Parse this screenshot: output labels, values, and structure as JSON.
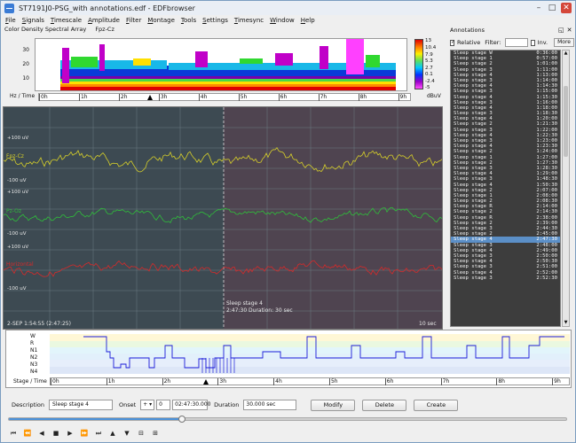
{
  "window": {
    "title": "ST7191J0-PSG_with annotations.edf - EDFbrowser",
    "controls": {
      "minimize": "–",
      "maximize": "□",
      "close": "✕"
    }
  },
  "menu": [
    "File",
    "Signals",
    "Timescale",
    "Amplitude",
    "Filter",
    "Montage",
    "Tools",
    "Settings",
    "Timesync",
    "Window",
    "Help"
  ],
  "csa": {
    "title": "Color Density Spectral Array",
    "channel": "Fpz-Cz",
    "y_ticks": [
      "30",
      "20",
      "10"
    ],
    "scale_labels": [
      "13",
      "10.4",
      "7.9",
      "5.3",
      "2.7",
      "0.1",
      "-2.4",
      "-5"
    ],
    "time_label": "Hz / Time",
    "unit": "dBuV",
    "time_ticks": [
      "0h",
      "1h",
      "2h",
      "3h",
      "4h",
      "5h",
      "6h",
      "7h",
      "8h",
      "9h"
    ],
    "cursor_hours": 2.79
  },
  "signals": {
    "amplitude_labels": [
      "+100 uV",
      "-100 uV",
      "+100 uV",
      "-100 uV",
      "+100 uV",
      "-100 uV"
    ],
    "channels": [
      {
        "name": "Fpz-Cz",
        "color": "#d6cf2a"
      },
      {
        "name": "Pz-Oz",
        "color": "#2fbf3a"
      },
      {
        "name": "Horizontal",
        "color": "#d62a2a"
      }
    ],
    "annotation_label": "Sleep stage 4",
    "annotation_detail": "2:47:30 Duration: 30 sec",
    "start_time": "2-SEP  1:54:55 (2:47:25)",
    "page_duration": "10 sec"
  },
  "annotations": {
    "title": "Annotations",
    "relative_label": "Relative",
    "relative_checked": true,
    "filter_label": "Filter:",
    "filter_value": "",
    "inv_label": "Inv.",
    "inv_checked": false,
    "more_label": "More",
    "rows": [
      [
        "Sleep stage W",
        "0:36:00"
      ],
      [
        "Sleep stage 1",
        "0:57:00"
      ],
      [
        "Sleep stage 2",
        "1:01:00"
      ],
      [
        "Sleep stage 3",
        "1:11:00"
      ],
      [
        "Sleep stage 4",
        "1:13:00"
      ],
      [
        "Sleep stage 3",
        "1:14:00"
      ],
      [
        "Sleep stage 4",
        "1:14:30"
      ],
      [
        "Sleep stage 3",
        "1:15:00"
      ],
      [
        "Sleep stage 4",
        "1:15:30"
      ],
      [
        "Sleep stage 3",
        "1:16:00"
      ],
      [
        "Sleep stage 4",
        "1:18:00"
      ],
      [
        "Sleep stage 3",
        "1:18:30"
      ],
      [
        "Sleep stage 4",
        "1:20:00"
      ],
      [
        "Sleep stage 2",
        "1:21:30"
      ],
      [
        "Sleep stage 3",
        "1:22:00"
      ],
      [
        "Sleep stage 4",
        "1:22:30"
      ],
      [
        "Sleep stage 3",
        "1:23:00"
      ],
      [
        "Sleep stage 4",
        "1:23:30"
      ],
      [
        "Sleep stage 2",
        "1:24:00"
      ],
      [
        "Sleep stage 1",
        "1:27:00"
      ],
      [
        "Sleep stage 2",
        "1:27:30"
      ],
      [
        "Sleep stage 3",
        "1:28:30"
      ],
      [
        "Sleep stage 4",
        "1:29:00"
      ],
      [
        "Sleep stage 3",
        "1:48:30"
      ],
      [
        "Sleep stage 4",
        "1:50:30"
      ],
      [
        "Sleep stage 2",
        "2:07:00"
      ],
      [
        "Sleep stage 1",
        "2:08:00"
      ],
      [
        "Sleep stage 2",
        "2:08:30"
      ],
      [
        "Sleep stage R",
        "2:14:00"
      ],
      [
        "Sleep stage 2",
        "2:14:30"
      ],
      [
        "Sleep stage R",
        "2:38:00"
      ],
      [
        "Sleep stage 2",
        "2:39:00"
      ],
      [
        "Sleep stage 3",
        "2:44:30"
      ],
      [
        "Sleep stage 2",
        "2:45:00"
      ],
      [
        "Sleep stage 4",
        "2:47:30"
      ],
      [
        "Sleep stage 3",
        "2:48:00"
      ],
      [
        "Sleep stage 4",
        "2:49:00"
      ],
      [
        "Sleep stage 3",
        "2:50:00"
      ],
      [
        "Sleep stage 4",
        "2:50:30"
      ],
      [
        "Sleep stage 3",
        "2:51:00"
      ],
      [
        "Sleep stage 4",
        "2:52:00"
      ],
      [
        "Sleep stage 3",
        "2:52:30"
      ]
    ],
    "selected_index": 34
  },
  "hypnogram": {
    "levels": [
      "W",
      "R",
      "N1",
      "N2",
      "N3",
      "N4"
    ],
    "time_label": "Stage / Time",
    "time_ticks": [
      "0h",
      "1h",
      "2h",
      "3h",
      "4h",
      "5h",
      "6h",
      "7h",
      "8h",
      "9h"
    ],
    "cursor_hours": 2.79
  },
  "editor": {
    "description_label": "Description",
    "description_value": "Sleep stage 4",
    "onset_label": "Onset",
    "onset_sign": "+",
    "onset_days": "0",
    "onset_time": "02:47:30.000",
    "duration_label": "Duration",
    "duration_value": "30.000 sec",
    "modify_label": "Modify",
    "delete_label": "Delete",
    "create_label": "Create"
  },
  "playback": {
    "position_fraction": 0.31,
    "buttons": [
      "⏮",
      "⏪",
      "◀",
      "■",
      "▶",
      "⏩",
      "⏭",
      "▲",
      "▼",
      "⊟",
      "⊞"
    ]
  }
}
